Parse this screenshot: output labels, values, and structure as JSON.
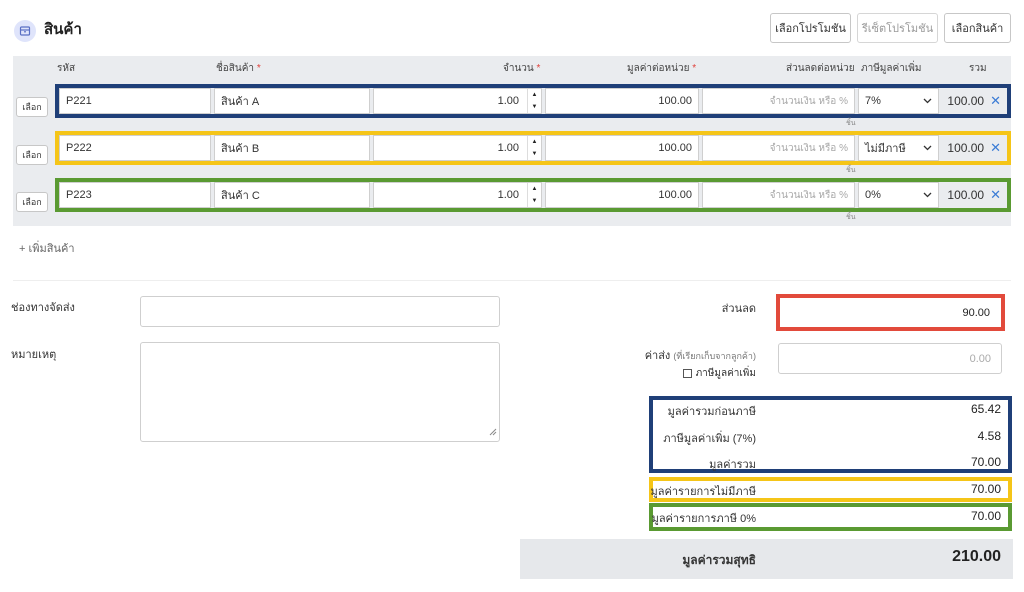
{
  "header": {
    "title": "สินค้า",
    "buttons": {
      "select_promotion": "เลือกโปรโมชัน",
      "reset_promotion": "รีเซ็ตโปรโมชัน",
      "select_product": "เลือกสินค้า"
    }
  },
  "table": {
    "columns": {
      "code": "รหัส",
      "name": "ชื่อสินค้า",
      "qty": "จำนวน",
      "unit_price": "มูลค่าต่อหน่วย",
      "discount": "ส่วนลดต่อหน่วย",
      "vat": "ภาษีมูลค่าเพิ่ม",
      "total": "รวม"
    },
    "required_mark": "*",
    "choose_label": "เลือก",
    "discount_placeholder": "จำนวนเงิน หรือ %",
    "unit_label": "ชิ้น",
    "rows": [
      {
        "code": "P221",
        "name": "สินค้า A",
        "qty": "1.00",
        "unit_price": "100.00",
        "vat": "7%",
        "total": "100.00",
        "highlight": "#1f3f78"
      },
      {
        "code": "P222",
        "name": "สินค้า B",
        "qty": "1.00",
        "unit_price": "100.00",
        "vat": "ไม่มีภาษี",
        "total": "100.00",
        "highlight": "#f5c518"
      },
      {
        "code": "P223",
        "name": "สินค้า C",
        "qty": "1.00",
        "unit_price": "100.00",
        "vat": "0%",
        "total": "100.00",
        "highlight": "#5a9a32"
      }
    ]
  },
  "add_product": "+ เพิ่มสินค้า",
  "form": {
    "shipping_label": "ช่องทางจัดส่ง",
    "shipping_value": "",
    "note_label": "หมายเหตุ",
    "note_value": ""
  },
  "summary": {
    "discount_label": "ส่วนลด",
    "discount_value": "90.00",
    "shipping_fee_label": "ค่าส่ง",
    "shipping_fee_hint": "(ที่เรียกเก็บจากลูกค้า)",
    "shipping_fee_placeholder": "0.00",
    "vat_checkbox_label": "ภาษีมูลค่าเพิ่ม",
    "pre_tax_label": "มูลค่ารวมก่อนภาษี",
    "pre_tax_value": "65.42",
    "vat_label": "ภาษีมูลค่าเพิ่ม (7%)",
    "vat_value": "4.58",
    "total_label": "มูลค่ารวม",
    "total_value": "70.00",
    "non_taxable_label": "มูลค่ารายการไม่มีภาษี",
    "non_taxable_value": "70.00",
    "zero_tax_label": "มูลค่ารายการภาษี 0%",
    "zero_tax_value": "70.00",
    "net_total_label": "มูลค่ารวมสุทธิ",
    "net_total_value": "210.00"
  },
  "colors": {
    "blue": "#1f3f78",
    "yellow": "#f5c518",
    "green": "#5a9a32",
    "red": "#e24a3b"
  }
}
